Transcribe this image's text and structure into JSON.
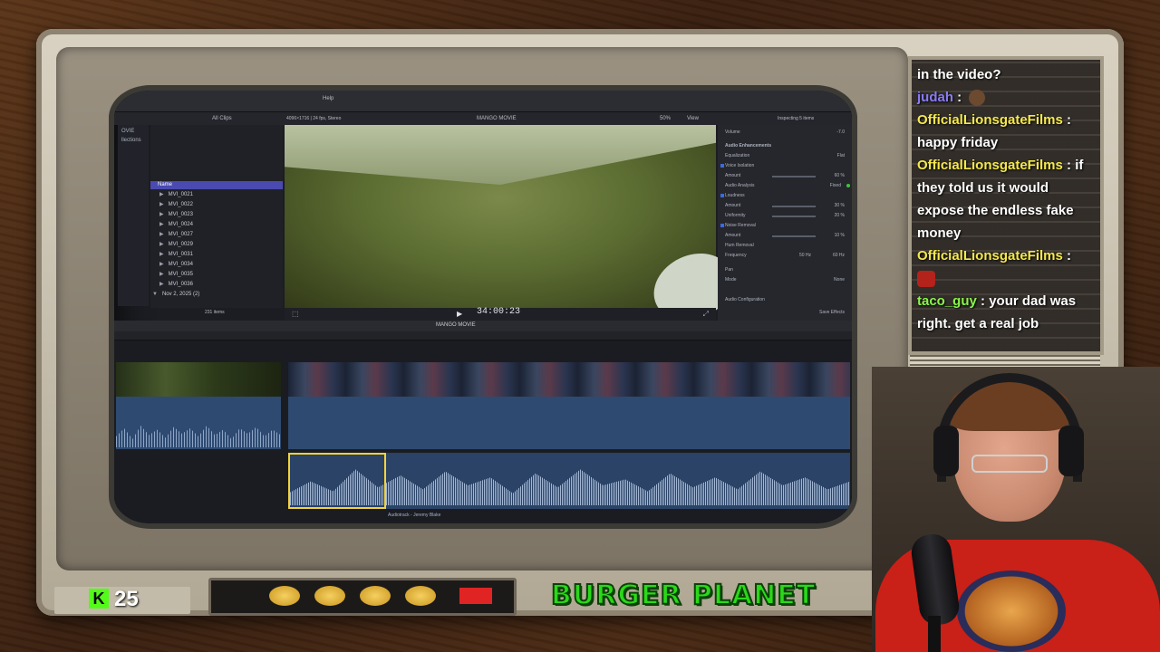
{
  "colors": {
    "kick_green": "#53fc18",
    "burger_green": "#2bd81a",
    "chat_purple": "#8a7cf5",
    "chat_yellow": "#f5e84a",
    "chat_green": "#8af54a",
    "selection_yellow": "#f3d33a",
    "browser_header_blue": "#4a4ab0"
  },
  "chat": {
    "top_fragment": "in the video?",
    "messages": [
      {
        "user": "judah",
        "separator": ":",
        "text": "",
        "has_avatar": true
      },
      {
        "user": "OfficialLionsgateFilms",
        "separator": ":",
        "text": "happy friday"
      },
      {
        "user": "OfficialLionsgateFilms",
        "separator": ":",
        "text": "if they told us it would expose the endless fake money"
      },
      {
        "user": "OfficialLionsgateFilms",
        "separator": ":",
        "text": "",
        "has_emote": true
      },
      {
        "user": "taco_guy",
        "separator": ":",
        "text": "your dad was right. get a real job"
      }
    ]
  },
  "overlay": {
    "kick_icon": "kick-logo-icon",
    "kick_letter": "K",
    "follower_count": "25",
    "banner_text": "BURGER PLANET"
  },
  "nle": {
    "top_menu": "Help",
    "filter": "All Clips",
    "format_info": "4096×1716 | 24 fps, Stereo",
    "project_name": "MANGO MOVIE",
    "zoom": "50%",
    "view_label": "View",
    "inspecting": "Inspecting 5 items",
    "library_items": [
      "OVIE",
      "llections"
    ],
    "browser_header": "Name",
    "clips": [
      "MVI_0021",
      "MVI_0022",
      "MVI_0023",
      "MVI_0024",
      "MVI_0027",
      "MVI_0029",
      "MVI_0031",
      "MVI_0034",
      "MVI_0035",
      "MVI_0036"
    ],
    "date_group": "Nov 2, 2025",
    "date_group_count": "(2)",
    "items_count": "231 items",
    "timecode": "34:00:23",
    "timeline_title": "MANGO MOVIE",
    "inspector": {
      "volume_label": "Volume",
      "volume_value": "-7.0",
      "section": "Audio Enhancements",
      "equalization": "Equalization",
      "equalization_value": "Flat",
      "voice_isolation": "Voice Isolation",
      "amount_label": "Amount",
      "amount1": "60 %",
      "audio_analysis": "Audio Analysis",
      "audio_analysis_value": "Fixed",
      "loudness": "Loudness",
      "amount2": "30 %",
      "uniformity": "Uniformity",
      "uniformity_value": "20 %",
      "noise_removal": "Noise Removal",
      "amount3": "10 %",
      "hum_removal": "Hum Removal",
      "frequency": "Frequency",
      "frequency_value": "50 Hz",
      "frequency_value2": "60 Hz",
      "pan": "Pan",
      "mode": "Mode",
      "mode_value": "None",
      "audio_config": "Audio Configuration",
      "save_effects": "Save Effects"
    },
    "music_clip_label": "Audiotrack - Jeremy Blake"
  }
}
